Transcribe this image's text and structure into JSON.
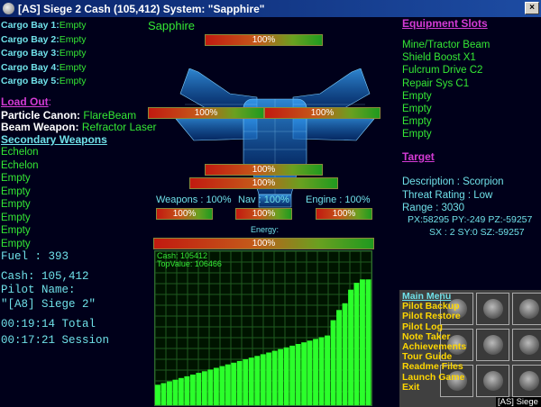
{
  "window": {
    "title": "[AS] Siege 2 Cash (105,412) System: \"Sapphire\""
  },
  "system_name": "Sapphire",
  "top_bar": "100%",
  "cargo": [
    {
      "label": "Cargo Bay 1:",
      "value": "Empty"
    },
    {
      "label": "Cargo Bay 2:",
      "value": "Empty"
    },
    {
      "label": "Cargo Bay 3:",
      "value": "Empty"
    },
    {
      "label": "Cargo Bay 4:",
      "value": "Empty"
    },
    {
      "label": "Cargo Bay 5:",
      "value": "Empty"
    }
  ],
  "loadout": {
    "header": "Load Out",
    "colon": ":",
    "particle_label": "Particle Canon:",
    "particle_value": "FlareBeam",
    "beam_label": "Beam Weapon:",
    "beam_value": "Refractor Laser",
    "secondary_header": "Secondary Weapons",
    "secondary": [
      "Echelon",
      "Echelon",
      "Empty",
      "Empty",
      "Empty",
      "Empty",
      "Empty",
      "Empty"
    ]
  },
  "stats": {
    "fuel": "Fuel : 393",
    "cash": "Cash: 105,412",
    "pilot_label": "Pilot Name:",
    "pilot_name": "\"[A8] Siege 2\"",
    "total_time": "00:19:14 Total",
    "session_time": "00:17:21 Session"
  },
  "ship_bars": {
    "left_wing": "100%",
    "right_wing": "100%",
    "mid1": "100%",
    "mid2": "100%"
  },
  "systems": {
    "weapons_label": "Weapons : 100%",
    "nav_label": "Nav : 100%",
    "engine_label": "Engine : 100%",
    "weapons_bar": "100%",
    "nav_bar": "100%",
    "engine_bar": "100%"
  },
  "energy": {
    "label": "Energy:",
    "bar": "100%"
  },
  "graph": {
    "cash_label": "Cash: 105412",
    "top_value_label": "TopValue: 106466"
  },
  "chart_data": {
    "type": "bar",
    "series": [
      {
        "values": [
          6,
          6.5,
          7,
          7.5,
          8,
          8.5,
          9,
          9.5,
          10,
          10.5,
          11,
          11.5,
          12,
          12.5,
          13,
          13.5,
          14,
          14.5,
          15,
          15.5,
          16,
          16.5,
          17,
          17.5,
          18,
          18.5,
          19,
          19.5,
          20,
          20.5,
          25,
          28,
          30,
          34,
          36,
          37,
          37
        ]
      }
    ],
    "ylim": [
      0,
      106466
    ]
  },
  "equipment": {
    "header": "Equipment Slots",
    "items": [
      "Mine/Tractor Beam",
      "Shield Boost X1",
      "Fulcrum Drive C2",
      "Repair Sys C1",
      "Empty",
      "Empty",
      "Empty",
      "Empty"
    ]
  },
  "target": {
    "header": "Target",
    "description": "Description : Scorpion",
    "threat": "Threat Rating : Low",
    "range": "Range : 3030",
    "pos": "PX:58295 PY:-249 PZ:-59257",
    "sector": "SX : 2 SY:0 SZ:-59257"
  },
  "menu": {
    "items": [
      "Main Menu",
      "Pilot Backup",
      "Pilot Restore",
      "Pilot Log",
      "Note Taker",
      "Achievements",
      "Tour Guide",
      "Readme Files",
      "Launch Game",
      "Exit"
    ]
  },
  "status_label": "[AS] Siege 2"
}
